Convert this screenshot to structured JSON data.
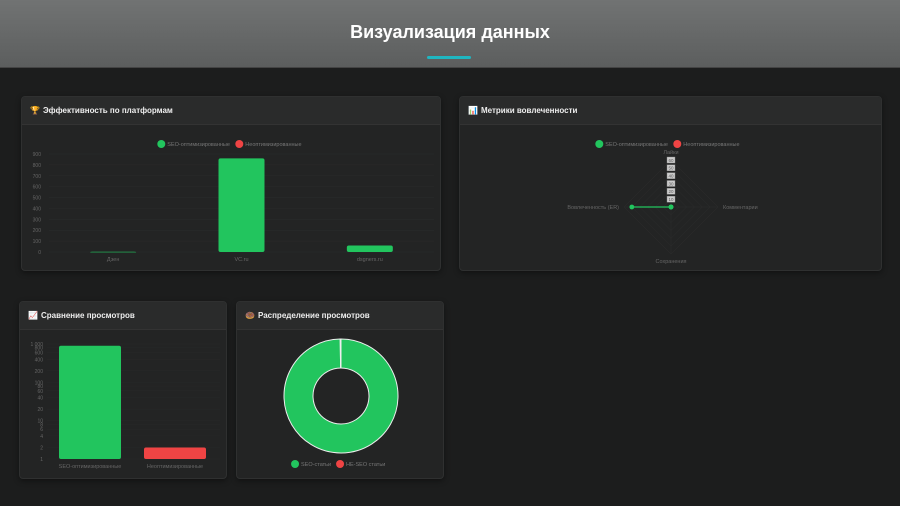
{
  "header": {
    "title": "Визуализация данных"
  },
  "colors": {
    "seo": "#22c55e",
    "non": "#ef4444",
    "accent": "#1fb6c1"
  },
  "cards": {
    "platforms": {
      "icon": "🏆",
      "title": "Эффективность по платформам"
    },
    "engagement": {
      "icon": "📊",
      "title": "Метрики вовлеченности"
    },
    "views": {
      "icon": "📈",
      "title": "Сравнение просмотров"
    },
    "distribution": {
      "icon": "🍩",
      "title": "Распределение просмотров"
    }
  },
  "chart_data": [
    {
      "type": "bar",
      "legend": [
        "SEO-оптимизированные",
        "Неоптимизированные"
      ],
      "categories": [
        "Дзен",
        "VC.ru",
        "dsgners.ru"
      ],
      "series": [
        {
          "name": "SEO-оптимизированные",
          "values": [
            2,
            860,
            60
          ]
        },
        {
          "name": "Неоптимизированные",
          "values": [
            0,
            0,
            0
          ]
        }
      ],
      "ylim": [
        0,
        900
      ],
      "yticks": [
        "0",
        "100",
        "200",
        "300",
        "400",
        "500",
        "600",
        "700",
        "800",
        "900"
      ],
      "legend_position": "top"
    },
    {
      "type": "radar",
      "legend": [
        "SEO-оптимизированные",
        "Неоптимизированные"
      ],
      "axes": [
        "Лайки",
        "Комментарии",
        "Сохранения",
        "Вовлеченность (ER)"
      ],
      "series": [
        {
          "name": "SEO-оптимизированные",
          "values": [
            0,
            0,
            0,
            50
          ]
        },
        {
          "name": "Неоптимизированные",
          "values": [
            0,
            0,
            0,
            0
          ]
        }
      ],
      "rlim": [
        0,
        60
      ],
      "rticks": [
        "10",
        "20",
        "30",
        "40",
        "50",
        "60"
      ]
    },
    {
      "type": "bar",
      "scale": "log",
      "categories": [
        "SEO-оптимизированные",
        "Неоптимизированные"
      ],
      "values": [
        900,
        2
      ],
      "ylim": [
        1,
        1000
      ],
      "yticks": [
        "1",
        "2",
        "4",
        "6",
        "8",
        "10",
        "20",
        "40",
        "60",
        "80",
        "100",
        "200",
        "400",
        "600",
        "800",
        "1 000"
      ]
    },
    {
      "type": "pie",
      "donut": true,
      "labels": [
        "SEO-статьи",
        "НЕ-SEO статьи"
      ],
      "values": [
        900,
        2
      ],
      "legend_position": "bottom"
    }
  ]
}
